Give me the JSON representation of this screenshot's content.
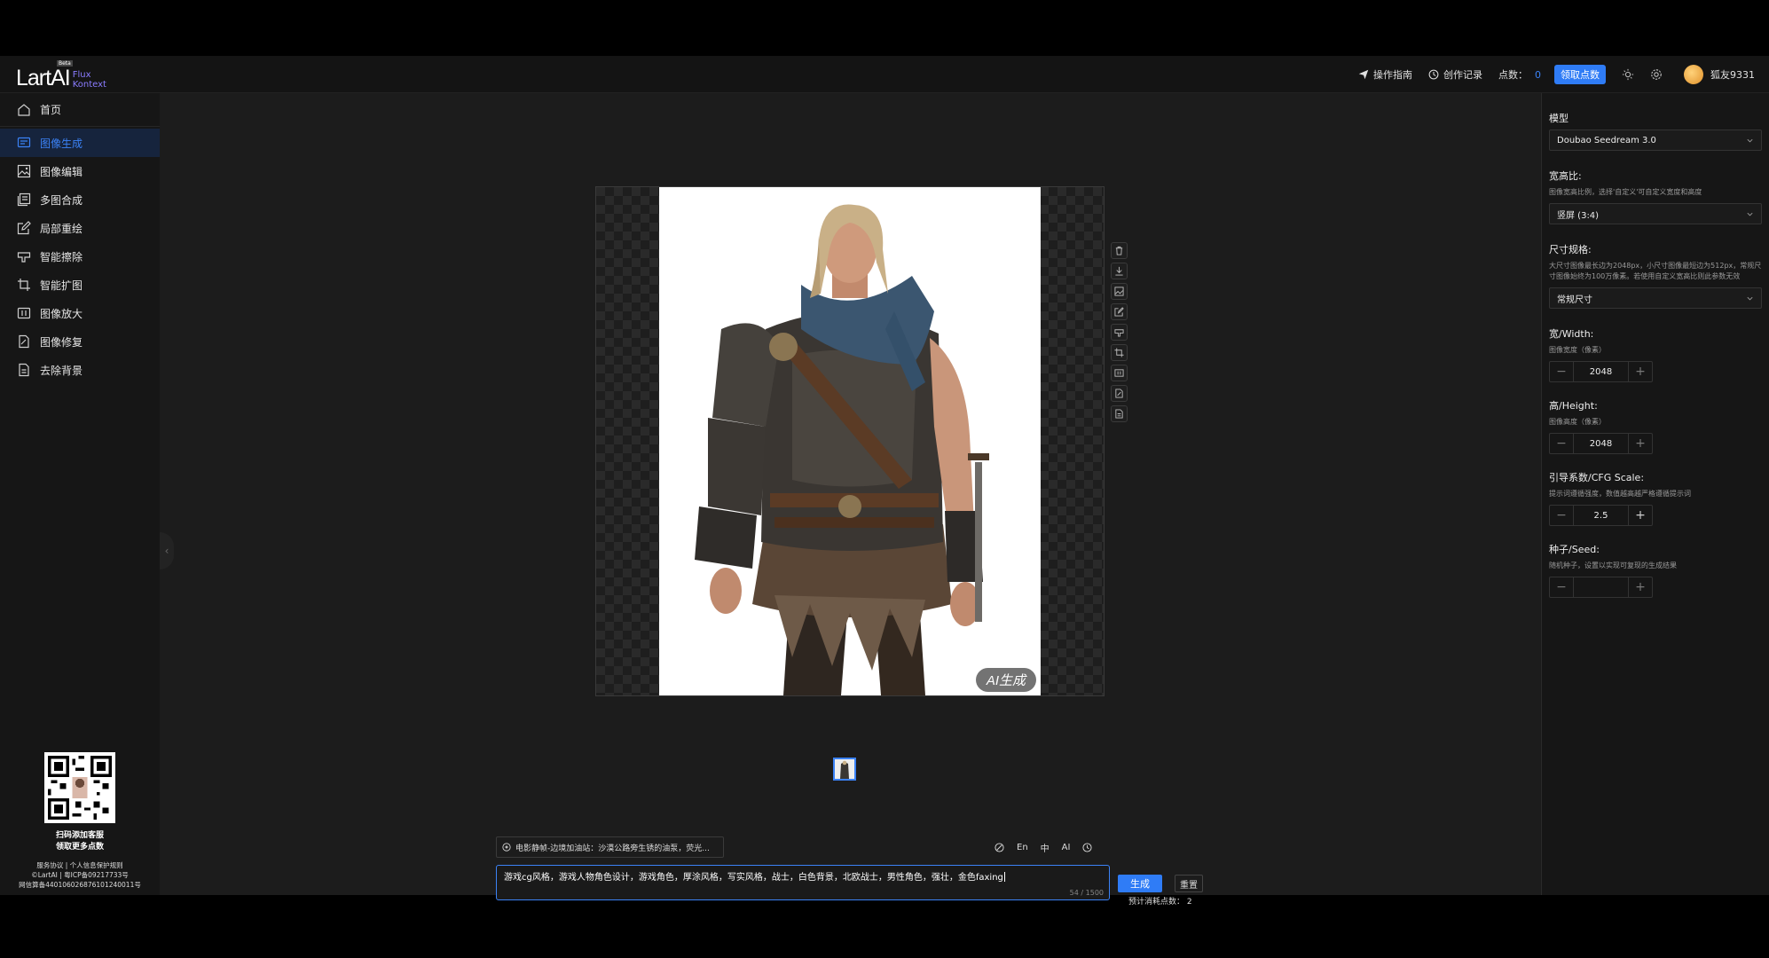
{
  "header": {
    "logo": "LartAI",
    "logo_beta": "Beta",
    "logo_sub_1": "Flux",
    "logo_sub_2": "Kontext",
    "guide": "操作指南",
    "history": "创作记录",
    "points_label": "点数：",
    "points_value": "0",
    "claim_points": "领取点数",
    "username": "狐友9331"
  },
  "sidebar": {
    "items": [
      {
        "label": "首页",
        "icon": "home-icon"
      },
      {
        "label": "图像生成",
        "icon": "chat-image-icon"
      },
      {
        "label": "图像编辑",
        "icon": "image-icon"
      },
      {
        "label": "多图合成",
        "icon": "layers-icon"
      },
      {
        "label": "局部重绘",
        "icon": "edit-icon"
      },
      {
        "label": "智能擦除",
        "icon": "eraser-icon"
      },
      {
        "label": "智能扩图",
        "icon": "crop-icon"
      },
      {
        "label": "图像放大",
        "icon": "upscale-icon"
      },
      {
        "label": "图像修复",
        "icon": "repair-icon"
      },
      {
        "label": "去除背景",
        "icon": "remove-bg-icon"
      }
    ],
    "qr_title": "扫码添加客服",
    "qr_subtitle": "领取更多点数",
    "footer_1": "服务协议 | 个人信息保护规则",
    "footer_2": "©LartAI | 粤ICP备09217733号",
    "footer_3": "网信算备440106026876101240011号"
  },
  "canvas": {
    "ai_badge": "AI生成",
    "tools": [
      "delete-icon",
      "download-icon",
      "image-edit-icon",
      "edit-icon",
      "eraser-icon",
      "crop-icon",
      "upscale-icon",
      "repair-icon",
      "remove-bg-icon"
    ]
  },
  "prompt": {
    "preset": "电影静帧-边境加油站：沙漠公路旁生锈的油泵，荧光...",
    "tool_en": "En",
    "tool_zh": "中",
    "tool_ai": "AI",
    "text": "游戏cg风格，游戏人物角色设计，游戏角色，厚涂风格，写实风格，战士，白色背景，北欧战士，男性角色，强壮，金色faxing",
    "counter": "54 / 1500",
    "generate": "生成",
    "reset": "重置",
    "estimate": "预计消耗点数： 2"
  },
  "settings": {
    "model_label": "模型",
    "model_value": "Doubao Seedream 3.0",
    "ratio_label": "宽高比:",
    "ratio_hint": "图像宽高比例，选择'自定义'可自定义宽度和高度",
    "ratio_value": "竖屏 (3:4)",
    "size_label": "尺寸规格:",
    "size_hint": "大尺寸图像最长边为2048px，小尺寸图像最短边为512px，常规尺寸图像始终为100万像素。若使用自定义宽高比则此参数无效",
    "size_value": "常规尺寸",
    "width_label": "宽/Width:",
    "width_hint": "图像宽度（像素）",
    "width_value": "2048",
    "height_label": "高/Height:",
    "height_hint": "图像高度（像素）",
    "height_value": "2048",
    "cfg_label": "引导系数/CFG Scale:",
    "cfg_hint": "提示词遵循强度，数值越高越严格遵循提示词",
    "cfg_value": "2.5",
    "seed_label": "种子/Seed:",
    "seed_hint": "随机种子，设置以实现可复现的生成结果",
    "seed_value": "",
    "minus": "−",
    "plus": "+"
  }
}
